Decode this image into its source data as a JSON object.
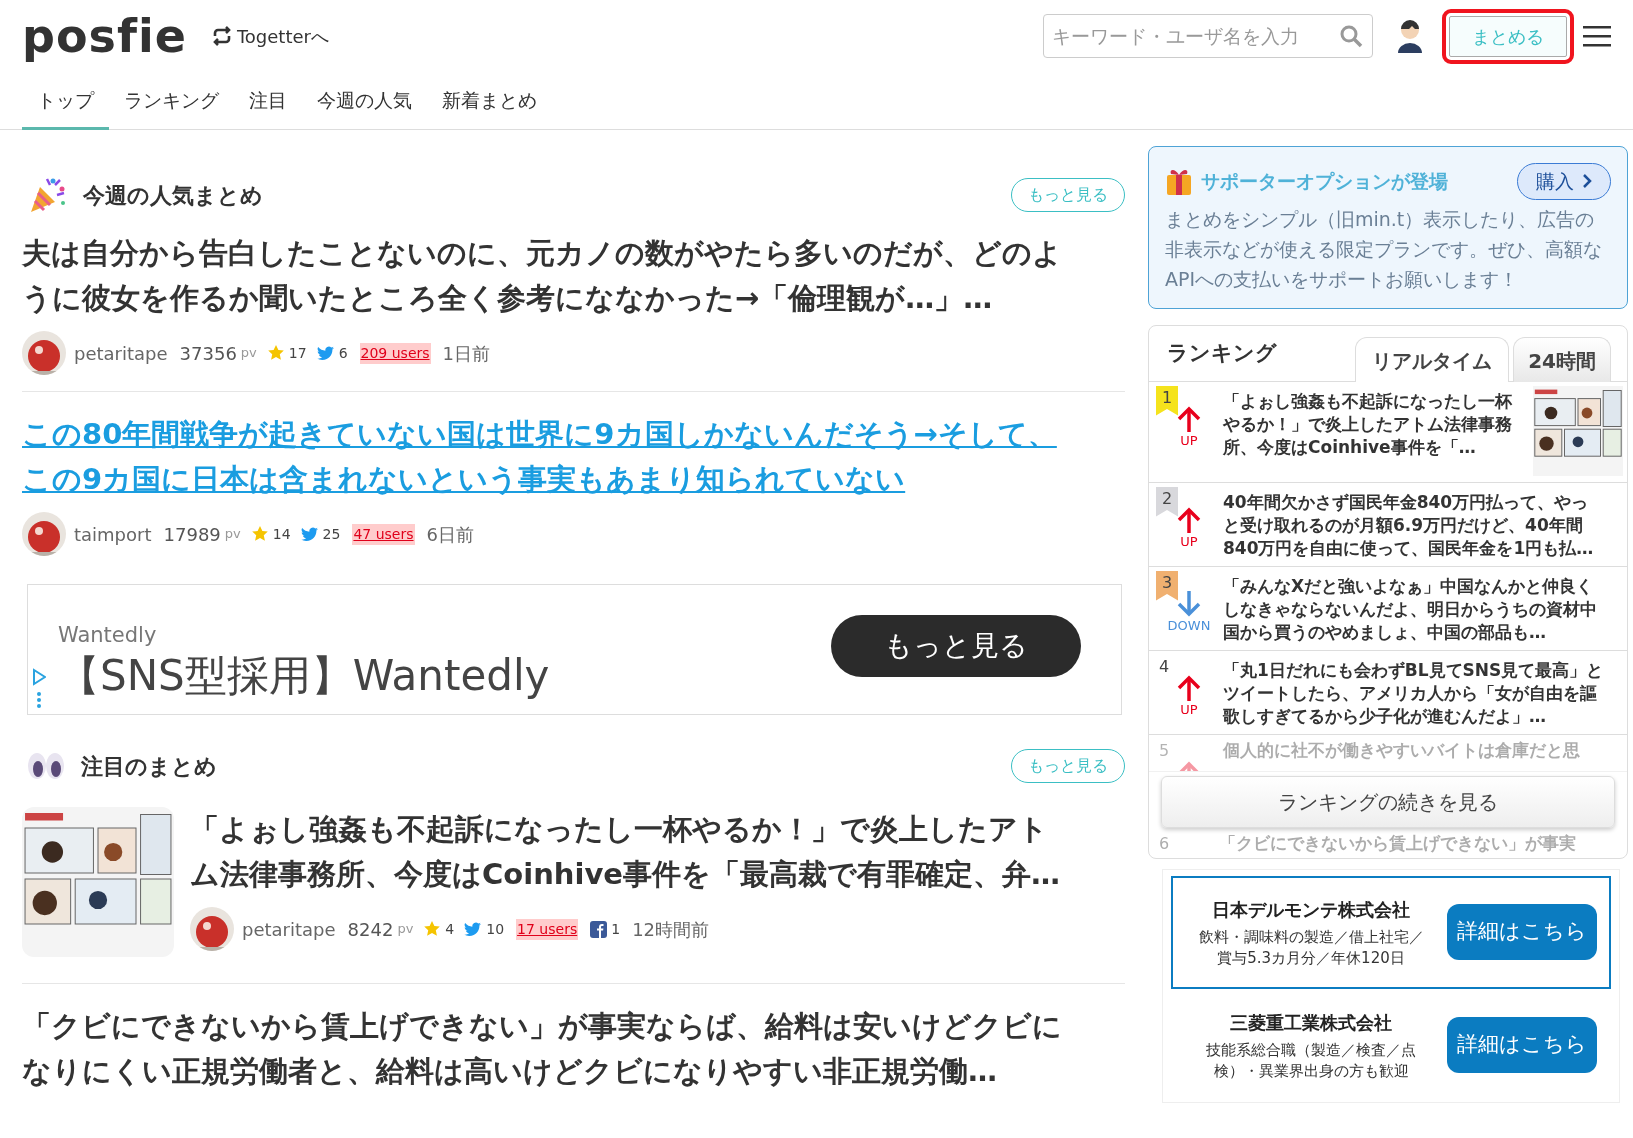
{
  "header": {
    "logo": "posfie",
    "togetter_link": "Togetterへ",
    "search": {
      "placeholder": "キーワード・ユーザ名を入力"
    },
    "create_button": {
      "label": "まとめる",
      "highlighted": true
    }
  },
  "nav": [
    {
      "label": "トップ",
      "selected": true
    },
    {
      "label": "ランキング",
      "selected": false
    },
    {
      "label": "注目",
      "selected": false
    },
    {
      "label": "今週の人気",
      "selected": false
    },
    {
      "label": "新着まとめ",
      "selected": false
    }
  ],
  "weekly": {
    "title": "今週の人気まとめ",
    "more": "もっと見る",
    "articles": [
      {
        "title": "夫は自分から告白したことないのに、元カノの数がやたら多いのだが、どのように彼女を作るか聞いたところ全く参考にななかった→「倫理観が…」…",
        "link": false,
        "author": "petaritape",
        "pv": "37356",
        "pv_unit": "pv",
        "favorites": "17",
        "tweets": "6",
        "users": "209 users",
        "time": "1日前"
      },
      {
        "title": "この80年間戦争が起きていない国は世界に9カ国しかないんだそう→そして、この9カ国に日本は含まれないという事実もあまり知られていない",
        "link": true,
        "author": "taimport",
        "pv": "17989",
        "pv_unit": "pv",
        "favorites": "14",
        "tweets": "25",
        "users": "47 users",
        "time": "6日前"
      }
    ]
  },
  "ad": {
    "sponsor": "Wantedly",
    "headline": "【SNS型採用】Wantedly",
    "button": "もっと見る"
  },
  "featured": {
    "title": "注目のまとめ",
    "more": "もっと見る",
    "articles": [
      {
        "title": "「よぉし強姦も不起訴になったし一杯やるか！」で炎上したアトム法律事務所、今度はCoinhive事件を「最高裁で有罪確定、弁…",
        "author": "petaritape",
        "pv": "8242",
        "pv_unit": "pv",
        "favorites": "4",
        "tweets": "10",
        "users": "17 users",
        "shares": "1",
        "time": "12時間前"
      }
    ]
  },
  "next_article": {
    "title": "「クビにできないから賃上げできない」が事実ならば、給料は安いけどクビになりにくい正規労働者と、給料は高いけどクビになりやすい非正規労働…"
  },
  "supporter": {
    "title": "サポーターオプションが登場",
    "button": "購入",
    "body": "まとめをシンプル（旧min.t）表示したり、広告の非表示などが使える限定プランです。ぜひ、高額なAPIへの支払いをサポートお願いします！"
  },
  "ranking": {
    "title": "ランキング",
    "tabs": [
      {
        "label": "リアルタイム",
        "selected": true
      },
      {
        "label": "24時間",
        "selected": false
      }
    ],
    "items": [
      {
        "rank": "1",
        "color": "#f5e31c",
        "kind": "up",
        "trend_label": "UP",
        "title": "「よぉし強姦も不起訴になったし一杯やるか！」で炎上したアトム法律事務所、今度はCoinhive事件を「…",
        "faded": false
      },
      {
        "rank": "2",
        "color": "#d8d8dc",
        "kind": "up",
        "trend_label": "UP",
        "title": "40年間欠かさず国民年金840万円払って、やっと受け取れるのが月額6.9万円だけど、40年間840万円を自由に使って、国民年金を1円も払…",
        "faded": false
      },
      {
        "rank": "3",
        "color": "#f0b070",
        "kind": "down",
        "trend_label": "DOWN",
        "title": "「みんなXだと強いよなぁ」中国なんかと仲良くしなきゃならないんだよ、明日からうちの資材中国から買うのやめましょ、中国の部品も…",
        "faded": false
      },
      {
        "rank": "4",
        "kind": "up",
        "trend_label": "UP",
        "title": "「丸1日だれにも会わずBL見てSNS見て最高」とツイートしたら、アメリカ人から「女が自由を謳歌しすぎてるから少子化が進むんだよ」…",
        "faded": false
      },
      {
        "rank": "5",
        "kind": "up",
        "title": "個人的に社不が働きやすいバイトは倉庫だと思",
        "faded": true
      }
    ],
    "more": "ランキングの続きを見る",
    "after": {
      "rank": "6",
      "title": "「クビにできないから賃上げできない」が事実"
    }
  },
  "jobs": [
    {
      "company": "日本デルモンテ株式会社",
      "description": "飲料・調味料の製造／借上社宅／賞与5.3カ月分／年休120日",
      "button": "詳細はこちら",
      "outlined": true
    },
    {
      "company": "三菱重工業株式会社",
      "description": "技能系総合職（製造／検査／点検）・異業界出身の方も歓迎",
      "button": "詳細はこちら",
      "outlined": false
    }
  ]
}
